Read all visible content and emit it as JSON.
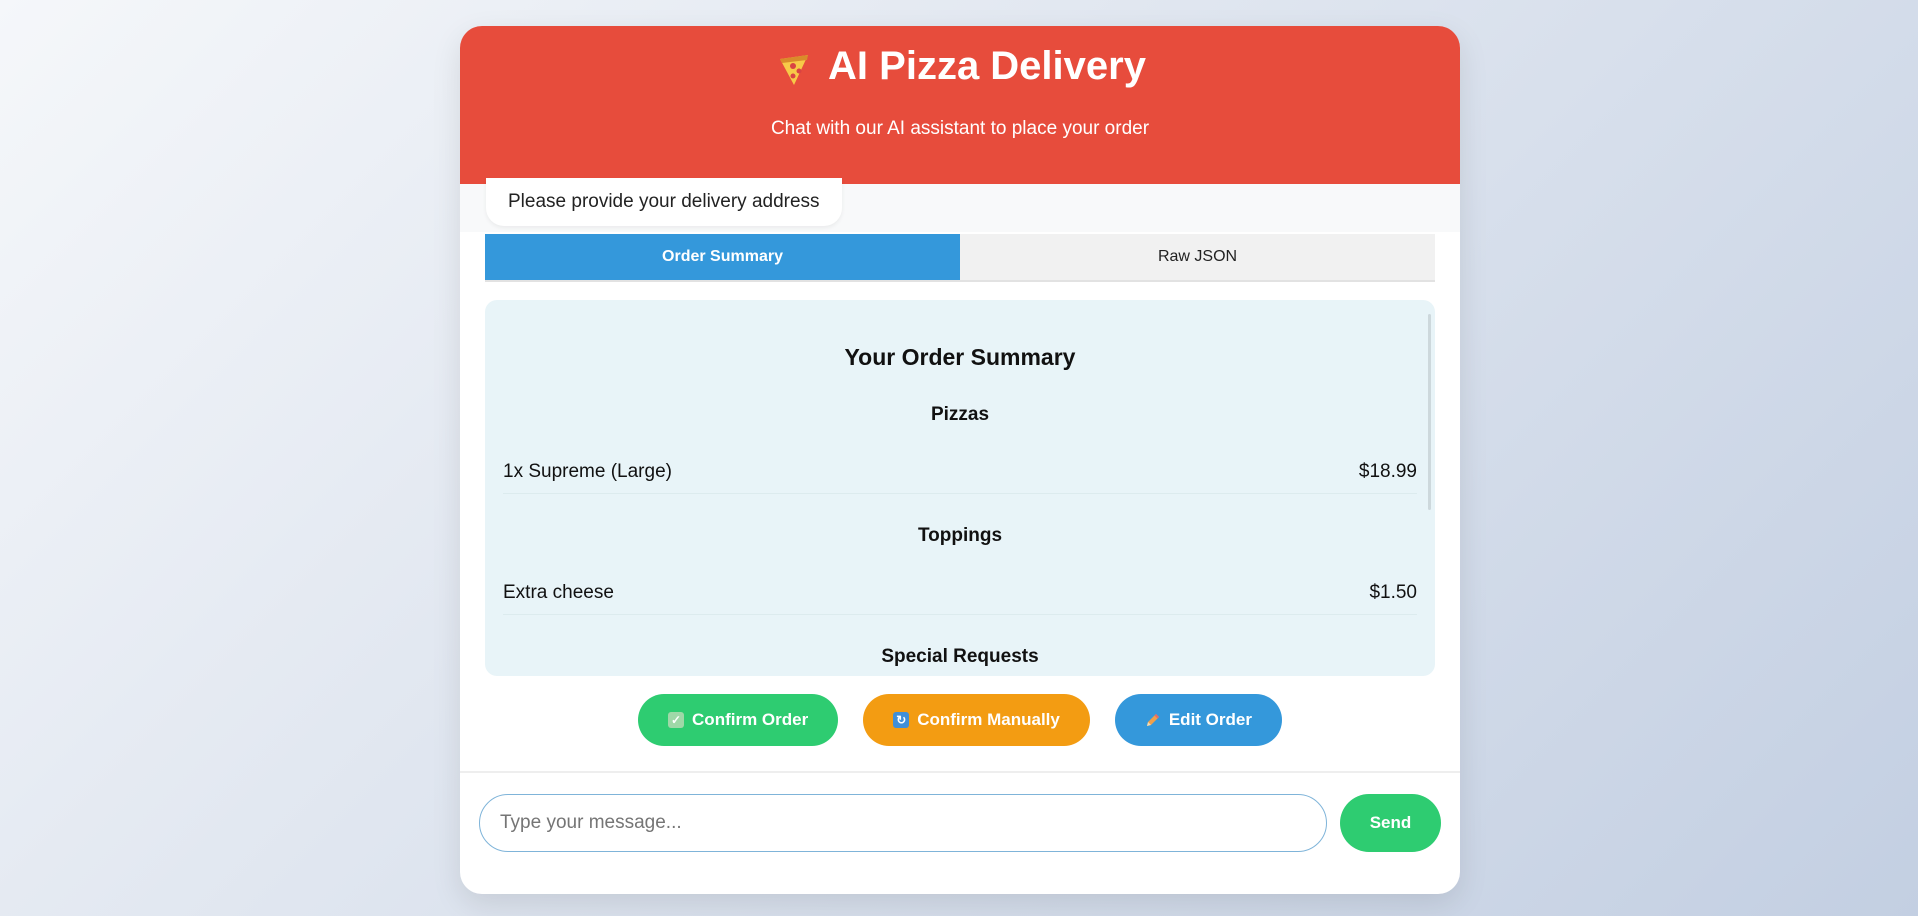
{
  "header": {
    "title": "AI Pizza Delivery",
    "subtitle": "Chat with our AI assistant to place your order",
    "icon": "pizza-slice-icon"
  },
  "chat": {
    "last_message": "Please provide your delivery address"
  },
  "tabs": [
    {
      "label": "Order Summary",
      "active": true
    },
    {
      "label": "Raw JSON",
      "active": false
    }
  ],
  "summary": {
    "title": "Your Order Summary",
    "sections": {
      "pizzas": {
        "title": "Pizzas",
        "items": [
          {
            "name": "1x Supreme (Large)",
            "price": "$18.99"
          }
        ]
      },
      "toppings": {
        "title": "Toppings",
        "items": [
          {
            "name": "Extra cheese",
            "price": "$1.50"
          }
        ]
      },
      "special": {
        "title": "Special Requests"
      }
    }
  },
  "actions": {
    "confirm": {
      "label": "Confirm Order",
      "icon": "checkbox-icon"
    },
    "manual": {
      "label": "Confirm Manually",
      "icon": "refresh-icon"
    },
    "edit": {
      "label": "Edit Order",
      "icon": "pencil-icon"
    }
  },
  "input": {
    "placeholder": "Type your message...",
    "send_label": "Send"
  },
  "colors": {
    "header": "#e74c3c",
    "accent_blue": "#3498db",
    "green": "#2ecc71",
    "orange": "#f39c12"
  }
}
